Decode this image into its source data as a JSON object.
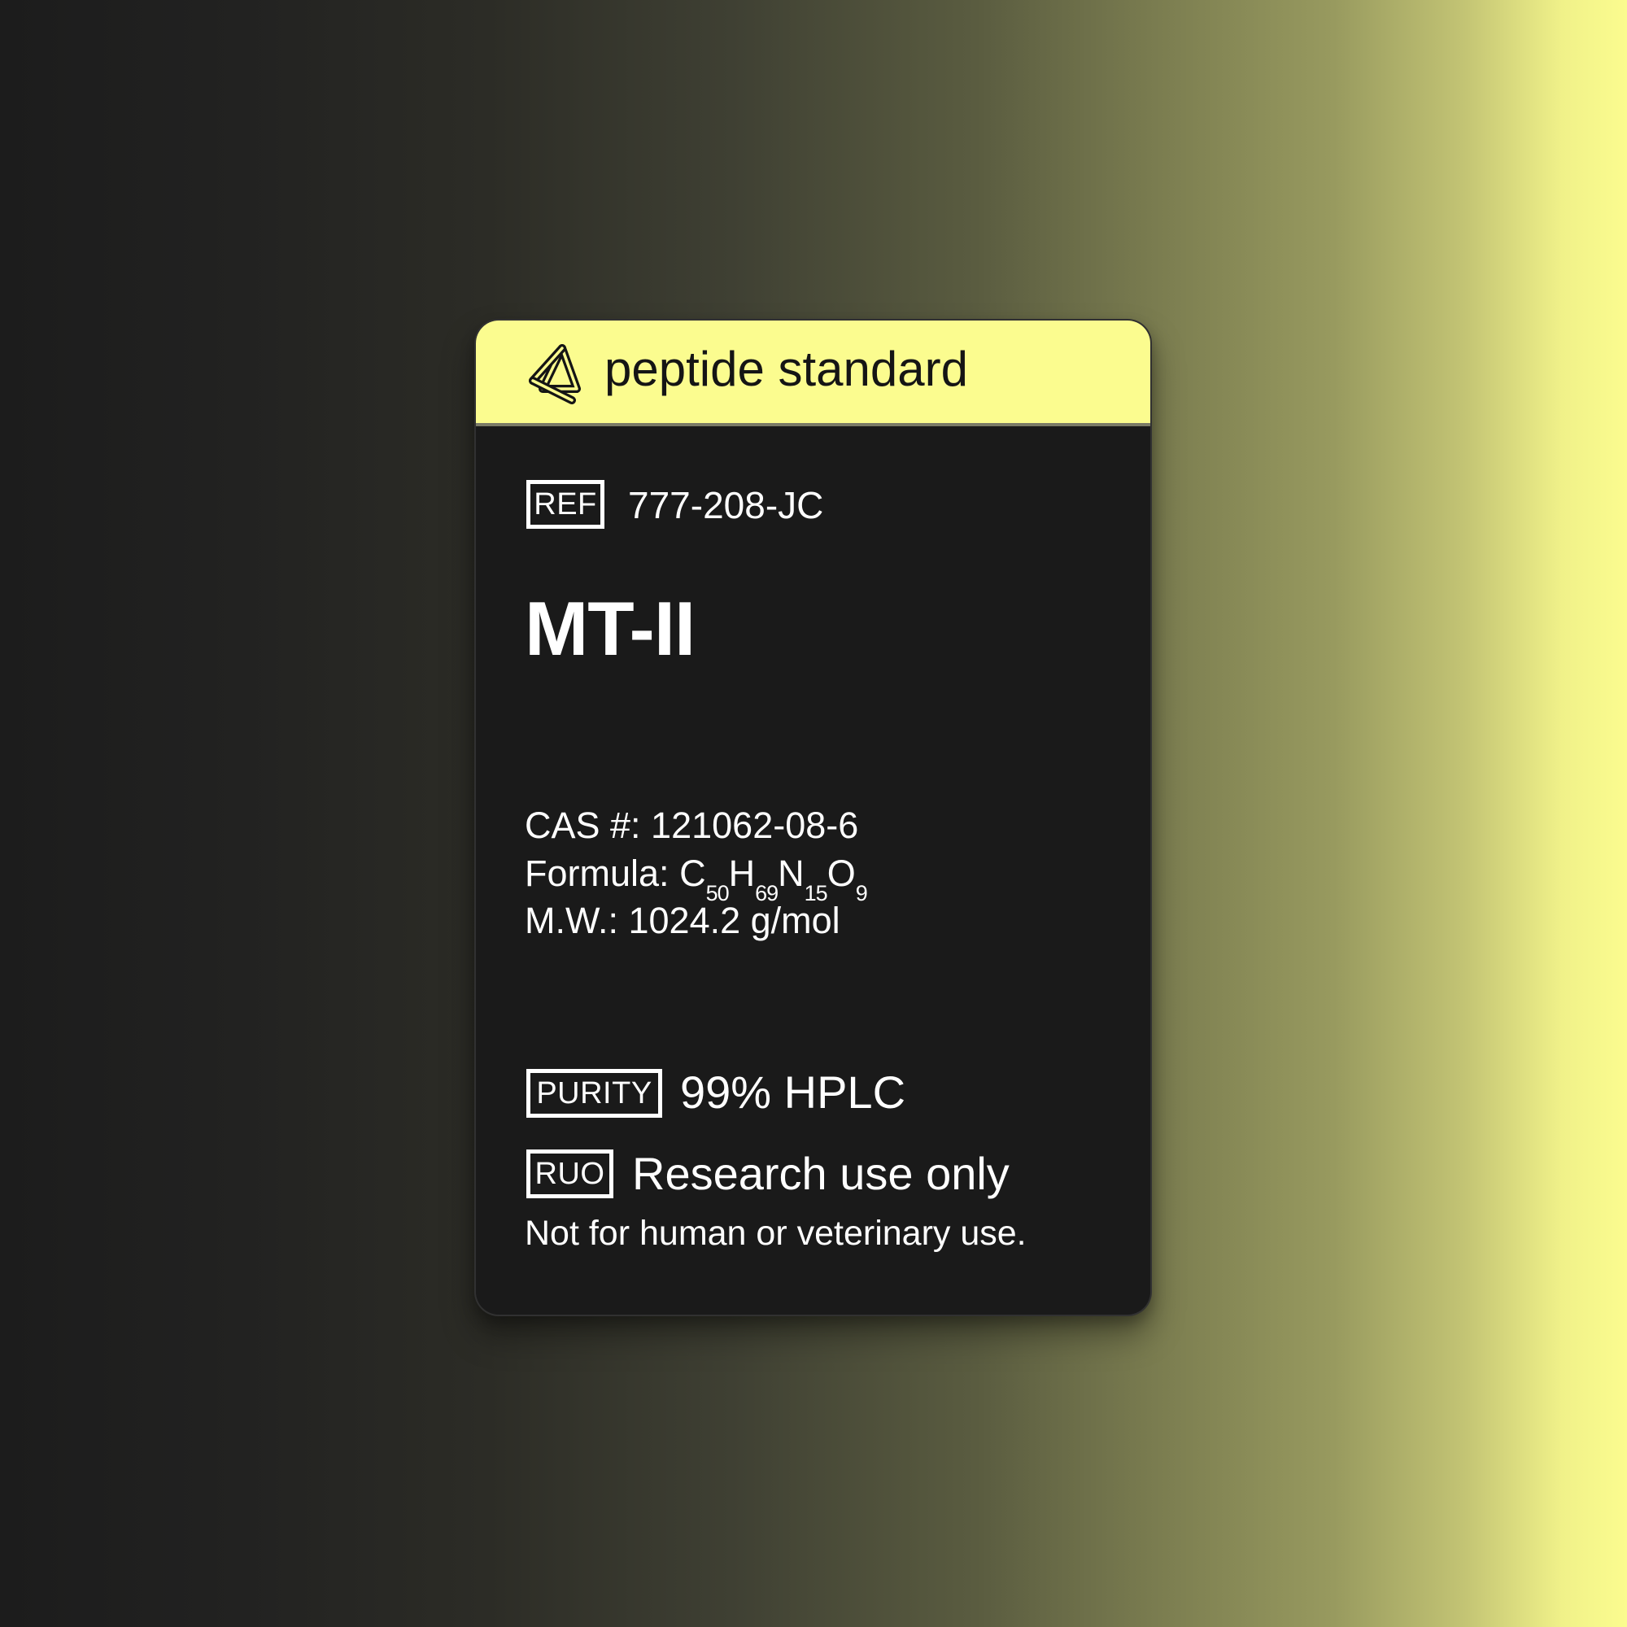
{
  "label": {
    "header": {
      "brand": "peptide standard",
      "logo_icon": "triangle-knot-logo-icon"
    },
    "ref": {
      "label": "REF",
      "value": "777-208-JC"
    },
    "product_name": "MT-II",
    "cas": "CAS #: 121062-08-6",
    "formula": {
      "prefix": "Formula:",
      "parts": [
        {
          "element": "C",
          "count": "50"
        },
        {
          "element": "H",
          "count": "69"
        },
        {
          "element": "N",
          "count": "15"
        },
        {
          "element": "O",
          "count": "9"
        }
      ]
    },
    "mw": "M.W.: 1024.2 g/mol",
    "purity": {
      "label": "PURITY",
      "value": "99% HPLC"
    },
    "ruo": {
      "label": "RUO",
      "value": "Research use only"
    },
    "disclaimer": "Not for human or veterinary use."
  },
  "colors": {
    "accent": "#fbfc8f",
    "card": "#1a1a1a",
    "text": "#ffffff"
  }
}
